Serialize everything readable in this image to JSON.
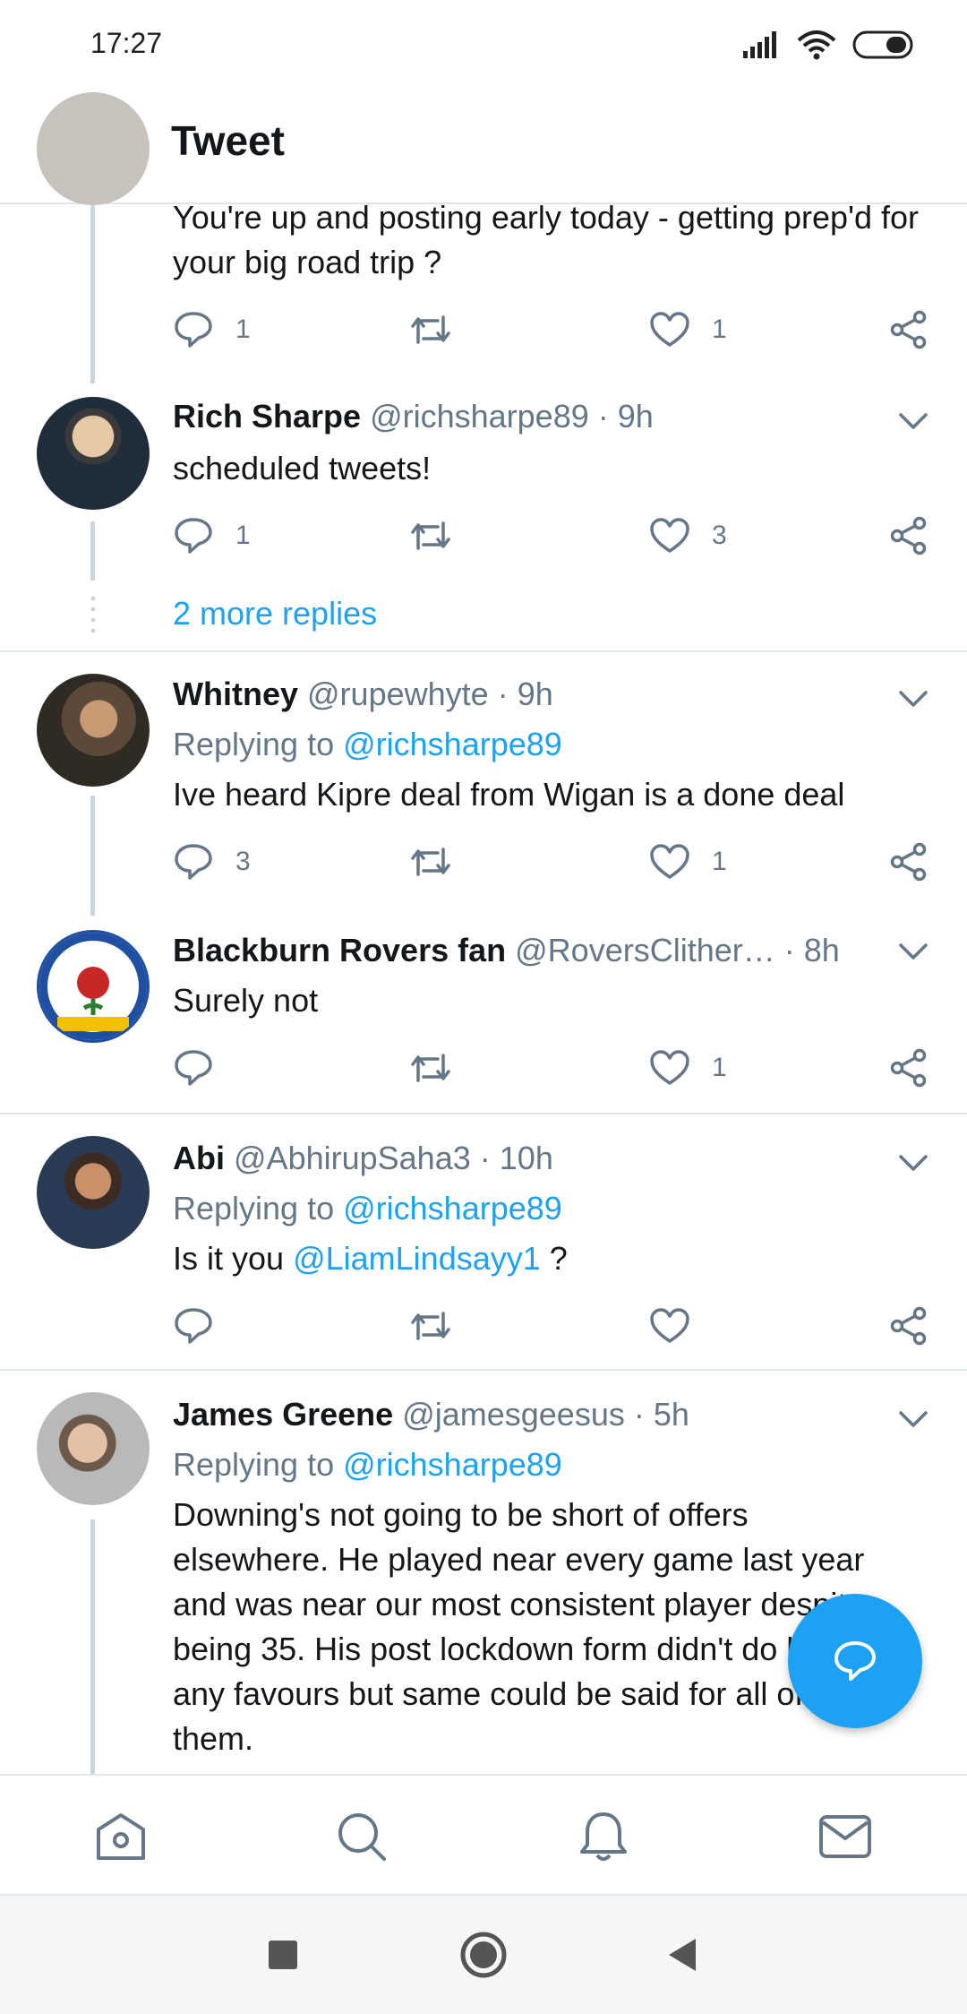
{
  "status_bar": {
    "time": "17:27"
  },
  "header": {
    "title": "Tweet"
  },
  "colors": {
    "accent": "#1da1f2",
    "secondary_text": "#657786",
    "primary_text": "#14171a"
  },
  "tweets": [
    {
      "text": "You're up and posting early today - getting prep'd for your big road trip ?",
      "reply_count": "1",
      "retweet_count": "",
      "like_count": "1"
    },
    {
      "name": "Rich Sharpe",
      "handle": "@richsharpe89",
      "time": "9h",
      "text": "scheduled tweets!",
      "reply_count": "1",
      "retweet_count": "",
      "like_count": "3",
      "more_replies": "2 more replies"
    },
    {
      "name": "Whitney",
      "handle": "@rupewhyte",
      "time": "9h",
      "replying_prefix": "Replying to",
      "replying_to": "@richsharpe89",
      "text": "Ive heard Kipre deal from Wigan is a done deal",
      "reply_count": "3",
      "retweet_count": "",
      "like_count": "1"
    },
    {
      "name": "Blackburn Rovers fan",
      "handle": "@RoversClither…",
      "time": "8h",
      "text": "Surely not",
      "reply_count": "",
      "retweet_count": "",
      "like_count": "1",
      "avatar_text": "BLACKBURN ROVERS F.C. TE ET LABO"
    },
    {
      "name": "Abi",
      "handle": "@AbhirupSaha3",
      "time": "10h",
      "replying_prefix": "Replying to",
      "replying_to": "@richsharpe89",
      "text_prefix": "Is it you",
      "text_mention": "@LiamLindsayy1",
      "text_suffix": "?",
      "reply_count": "",
      "retweet_count": "",
      "like_count": ""
    },
    {
      "name": "James Greene",
      "handle": "@jamesgeesus",
      "time": "5h",
      "replying_prefix": "Replying to",
      "replying_to": "@richsharpe89",
      "lines": [
        "Downing's not going to be short of offers",
        "elsewhere. He played near every game last year",
        "and was near our most consistent player despite",
        "being 35. His post lockdown form didn't do him",
        "any favours but same could be said for all of",
        "them."
      ]
    }
  ],
  "dot": "·",
  "icons": {
    "back": "arrow-left-icon",
    "reply": "speech-bubble-icon",
    "retweet": "retweet-icon",
    "like": "heart-icon",
    "share": "share-icon",
    "chevron": "chevron-down-icon",
    "fab": "compose-reply-icon",
    "home": "home-icon",
    "search": "search-icon",
    "notifications": "bell-icon",
    "messages": "mail-icon"
  }
}
